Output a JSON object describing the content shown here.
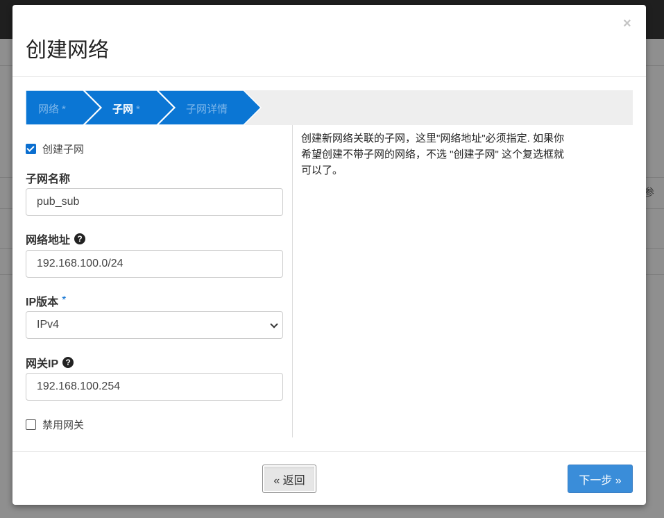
{
  "modal": {
    "title": "创建网络",
    "close_glyph": "×"
  },
  "wizard": {
    "steps": [
      {
        "label": "网络",
        "required": "*",
        "state": "done"
      },
      {
        "label": "子网",
        "required": "*",
        "state": "active"
      },
      {
        "label": "子网详情",
        "required": "",
        "state": "pending"
      }
    ],
    "colors": {
      "step_fill": "#0b76d4",
      "inactive_text": "#7fb7ea",
      "active_text": "#ffffff"
    }
  },
  "form": {
    "create_subnet": {
      "label": "创建子网",
      "checked": true
    },
    "subnet_name": {
      "label": "子网名称",
      "value": "pub_sub"
    },
    "network_address": {
      "label": "网络地址",
      "help_icon": "question-circle-icon",
      "value": "192.168.100.0/24"
    },
    "ip_version": {
      "label": "IP版本",
      "required": "*",
      "selected": "IPv4"
    },
    "gateway_ip": {
      "label": "网关IP",
      "help_icon": "question-circle-icon",
      "value": "192.168.100.254"
    },
    "disable_gateway": {
      "label": "禁用网关",
      "checked": false
    }
  },
  "help": {
    "lines": [
      "创建新网络关联的子网，这里\"网络地址\"必须指定. 如果你",
      "希望创建不带子网的网络，不选 \"创建子网\" 这个复选框就",
      "可以了。"
    ]
  },
  "footer": {
    "back_label": "« 返回",
    "next_label": "下一步 »"
  },
  "background": {
    "side_glyph": "参"
  }
}
